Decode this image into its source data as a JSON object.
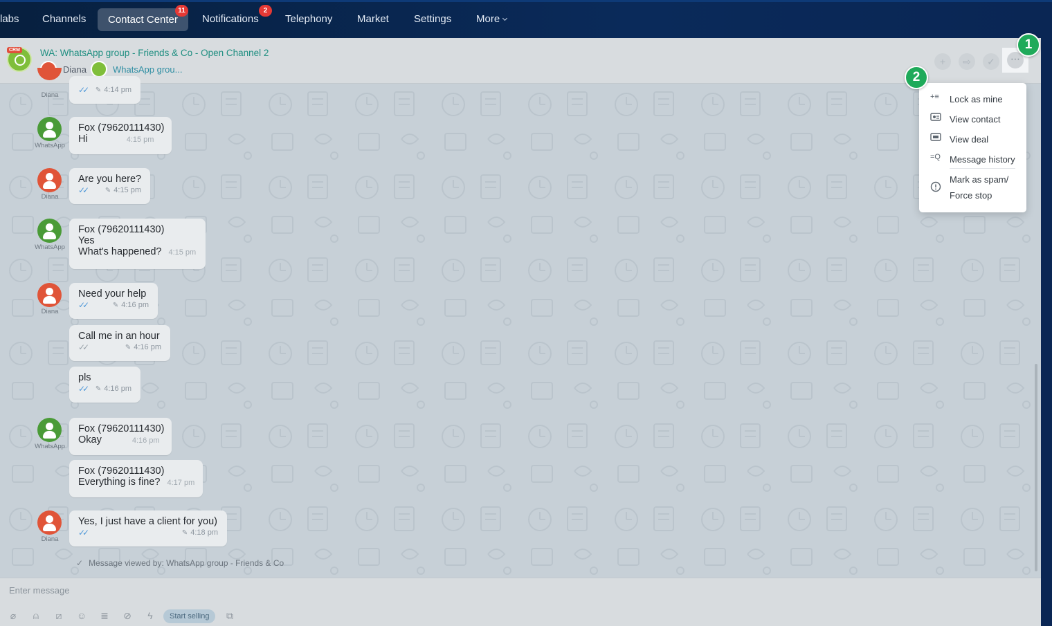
{
  "topnav": {
    "items": [
      {
        "label": "labs"
      },
      {
        "label": "Channels"
      },
      {
        "label": "Contact Center",
        "badge": "11"
      },
      {
        "label": "Notifications",
        "badge": "2"
      },
      {
        "label": "Telephony"
      },
      {
        "label": "Market"
      },
      {
        "label": "Settings"
      },
      {
        "label": "More"
      }
    ]
  },
  "header": {
    "crm_badge": "CRM",
    "title": "WA: WhatsApp group - Friends & Co - Open Channel 2",
    "operator": "Diana",
    "channel_link": "WhatsApp grou..."
  },
  "callouts": [
    "1",
    "2"
  ],
  "menu": {
    "items": [
      {
        "label": "Lock as mine",
        "icon": "lock-as-mine-icon"
      },
      {
        "label": "View contact",
        "icon": "contact-card-icon"
      },
      {
        "label": "View deal",
        "icon": "deal-card-icon"
      },
      {
        "label": "Message history",
        "icon": "history-search-icon"
      },
      {
        "label_line1": "Mark as spam/",
        "label_line2": "Force stop",
        "icon": "alert-circle-icon"
      }
    ]
  },
  "messages": [
    {
      "avatar_label": "Diana",
      "time": "4:14 pm"
    },
    {
      "avatar_label": "WhatsApp",
      "sender": "Fox (79620111430)",
      "lines": [
        "Hi"
      ],
      "time": "4:15 pm"
    },
    {
      "avatar_label": "Diana",
      "lines": [
        "Are you here?"
      ],
      "time": "4:15 pm"
    },
    {
      "avatar_label": "WhatsApp",
      "sender": "Fox (79620111430)",
      "lines": [
        "Yes",
        "What's happened?"
      ],
      "time": "4:15 pm"
    },
    {
      "avatar_label": "Diana",
      "lines": [
        "Need your help"
      ],
      "time": "4:16 pm"
    },
    {
      "lines": [
        "Call me in an hour"
      ],
      "time": "4:16 pm"
    },
    {
      "lines": [
        "pls"
      ],
      "time": "4:16 pm"
    },
    {
      "avatar_label": "WhatsApp",
      "sender": "Fox (79620111430)",
      "lines": [
        "Okay"
      ],
      "time": "4:16 pm"
    },
    {
      "sender": "Fox (79620111430)",
      "lines": [
        "Everything is fine?"
      ],
      "time": "4:17 pm"
    },
    {
      "avatar_label": "Diana",
      "lines": [
        "Yes, I just have a client for you)"
      ],
      "time": "4:18 pm"
    }
  ],
  "viewed_text": "Message viewed by: WhatsApp group - Friends & Co",
  "input": {
    "placeholder": "Enter message",
    "start_selling": "Start selling"
  },
  "colors": {
    "nav_bg": "#0a2654",
    "accent_green": "#1faa5a",
    "link_teal": "#1e8e80",
    "badge_red": "#e53935"
  }
}
